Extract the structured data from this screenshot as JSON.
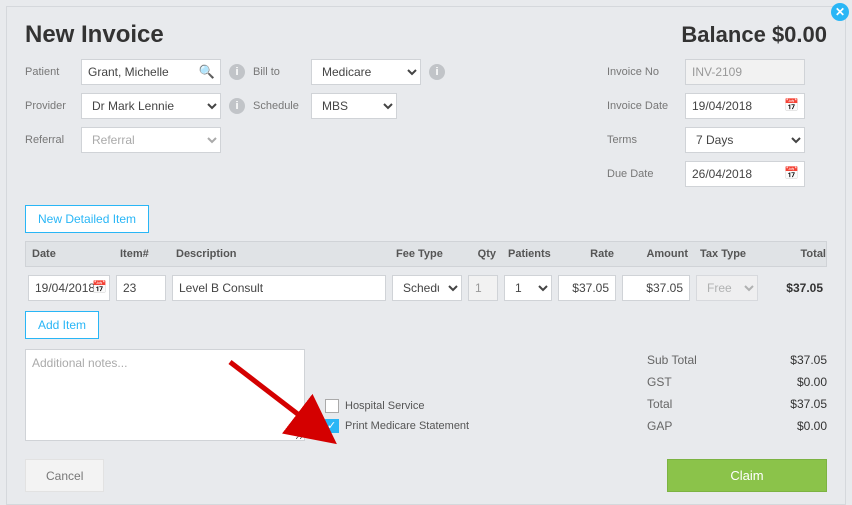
{
  "header": {
    "title": "New Invoice",
    "balance_label": "Balance",
    "balance_value": "$0.00"
  },
  "form": {
    "patient_label": "Patient",
    "patient_value": "Grant, Michelle",
    "billto_label": "Bill to",
    "billto_value": "Medicare",
    "provider_label": "Provider",
    "provider_value": "Dr Mark Lennie",
    "schedule_label": "Schedule",
    "schedule_value": "MBS",
    "referral_label": "Referral",
    "referral_placeholder": "Referral",
    "invoice_no_label": "Invoice No",
    "invoice_no_value": "INV-2109",
    "invoice_date_label": "Invoice Date",
    "invoice_date_value": "19/04/2018",
    "terms_label": "Terms",
    "terms_value": "7 Days",
    "due_date_label": "Due Date",
    "due_date_value": "26/04/2018"
  },
  "buttons": {
    "new_detailed_item": "New Detailed Item",
    "add_item": "Add Item",
    "cancel": "Cancel",
    "claim": "Claim"
  },
  "line_header": {
    "date": "Date",
    "item": "Item#",
    "desc": "Description",
    "fee_type": "Fee Type",
    "qty": "Qty",
    "patients": "Patients",
    "rate": "Rate",
    "amount": "Amount",
    "tax_type": "Tax Type",
    "total": "Total"
  },
  "line": {
    "date": "19/04/2018",
    "item": "23",
    "desc": "Level B Consult",
    "fee_type": "Schedule",
    "qty": "1",
    "patients": "1",
    "rate": "$37.05",
    "amount": "$37.05",
    "tax_type": "Free",
    "total": "$37.05"
  },
  "notes_placeholder": "Additional notes...",
  "checks": {
    "hospital": "Hospital Service",
    "print_medicare": "Print Medicare Statement"
  },
  "totals": {
    "sub_label": "Sub Total",
    "sub_val": "$37.05",
    "gst_label": "GST",
    "gst_val": "$0.00",
    "total_label": "Total",
    "total_val": "$37.05",
    "gap_label": "GAP",
    "gap_val": "$0.00"
  }
}
